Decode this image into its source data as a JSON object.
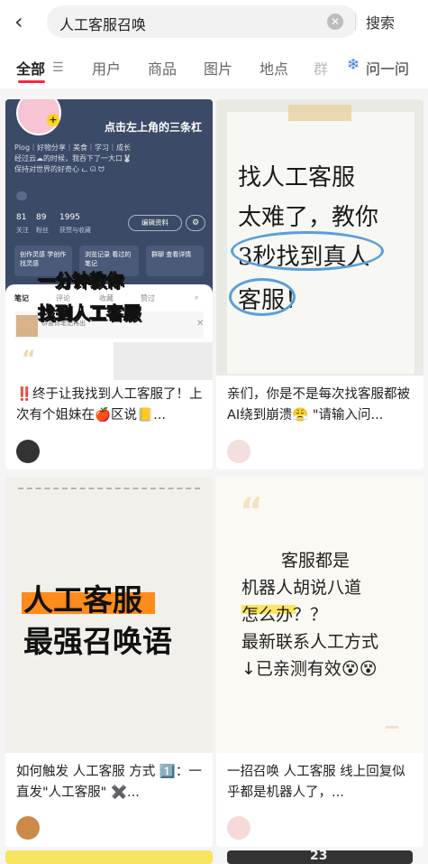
{
  "search": {
    "back_icon": "back-arrow-icon",
    "query": "人工客服召唤",
    "clear_icon": "clear-icon",
    "button": "搜索"
  },
  "tabs": {
    "items": [
      {
        "label": "全部",
        "active": true
      },
      {
        "label": "用户"
      },
      {
        "label": "商品"
      },
      {
        "label": "图片"
      },
      {
        "label": "地点"
      },
      {
        "label": "群"
      }
    ],
    "filter_icon": "filter-icon",
    "ask_icon": "ask-icon",
    "ask_label": "问一问"
  },
  "cards": [
    {
      "image": {
        "bubble": "点击左上角的三条杠",
        "lines": [
          "Plog｜好物分享｜美食｜学习｜成长",
          "经过云☁的时候，我吞下了一大口🐰",
          "保持对世界的好奇心 ᓚ ᘏ ᗢ"
        ],
        "stats": [
          {
            "value": "81",
            "label": "关注"
          },
          {
            "value": "89",
            "label": "粉丝"
          },
          {
            "value": "1995",
            "label": "获赞与收藏"
          }
        ],
        "edit_label": "编辑资料",
        "chips": [
          "创作灵感\n学创作找灵感",
          "浏览记录\n看过的笔记",
          "群聊\n查看详情"
        ],
        "overlay": [
          "一分钟教你",
          "找到人工客服"
        ],
        "sheet_tabs": [
          "笔记",
          "评论",
          "收藏",
          "赞过"
        ],
        "sheet_ad": "恭喜你笔记再出"
      },
      "title": "‼️终于让我找到人工客服了！上次有个姐妹在🍎区说📒..."
    },
    {
      "image": {
        "lines": [
          "找人工客服",
          "太难了，教你",
          "3秒找到真人",
          "客服！"
        ]
      },
      "title": "亲们，你是不是每次找客服都被AI绕到崩溃😤 \"请输入问..."
    },
    {
      "image": {
        "lines": [
          "人工客服",
          "最强召唤语"
        ]
      },
      "title": "如何触发 人工客服 方式 1️⃣：一直发\"人工客服\" ✖️..."
    },
    {
      "image": {
        "quote": "“",
        "lines": [
          "客服都是",
          "机器人胡说八道",
          "怎么办？？",
          "最新联系人工方式",
          "↓已亲测有效😵😵"
        ]
      },
      "title": "一招召唤 人工客服 线上回复似乎都是机器人了，..."
    }
  ],
  "partial": {
    "c6_text": "23"
  }
}
